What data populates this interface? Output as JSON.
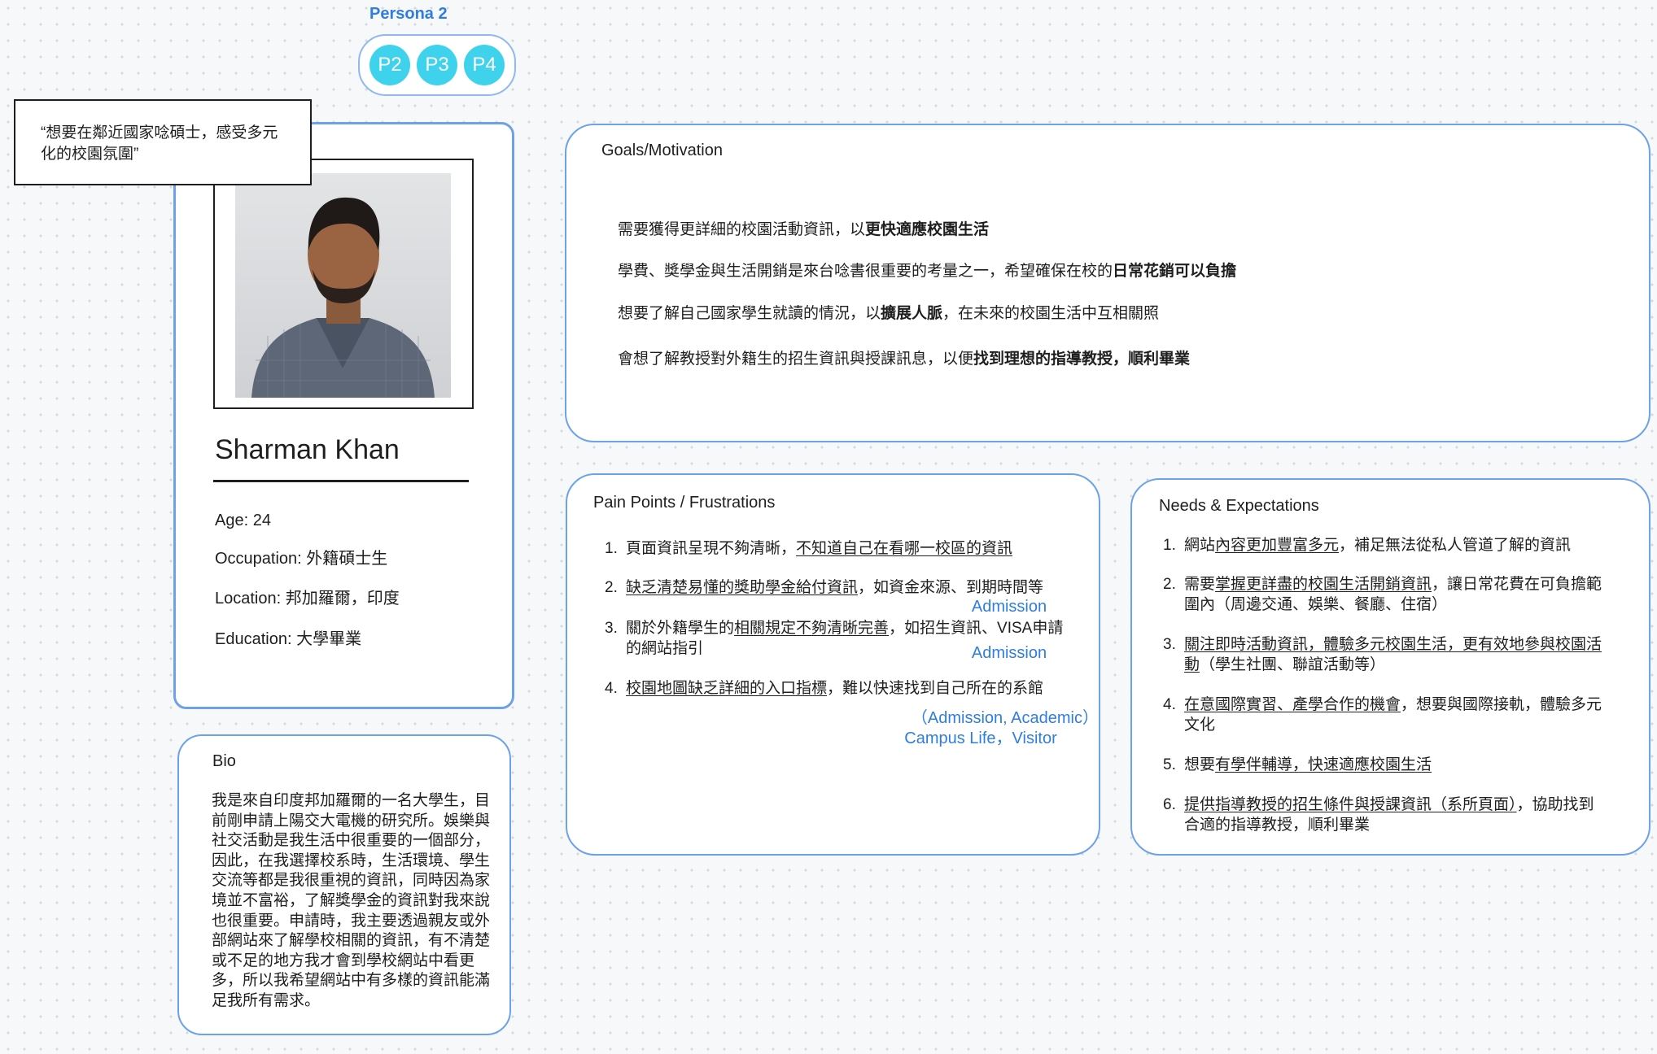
{
  "frame_label": "Persona 2",
  "persona_chips": [
    "P2",
    "P3",
    "P4"
  ],
  "quote": "“想要在鄰近國家唸碩士，感受多元化的校園氛圍”",
  "profile": {
    "name": "Sharman Khan",
    "age_label": "Age: ",
    "age": "24",
    "occupation_label": "Occupation: ",
    "occupation": "外籍碩士生",
    "location_label": "Location: ",
    "location": "邦加羅爾，印度",
    "education_label": "Education: ",
    "education": "大學畢業"
  },
  "bio": {
    "title": "Bio",
    "text": "我是來自印度邦加羅爾的一名大學生，目前剛申請上陽交大電機的研究所。娛樂與社交活動是我生活中很重要的一個部分，因此，在我選擇校系時，生活環境、學生交流等都是我很重視的資訊，同時因為家境並不富裕，了解獎學金的資訊對我來說也很重要。申請時，我主要透過親友或外部網站來了解學校相關的資訊，有不清楚或不足的地方我才會到學校網站中看更多，所以我希望網站中有多樣的資訊能滿足我所有需求。"
  },
  "goals": {
    "title": "Goals/Motivation",
    "items": [
      {
        "pre": "需要獲得更詳細的校園活動資訊，以",
        "bold": "更快適應校園生活",
        "post": ""
      },
      {
        "pre": "學費、獎學金與生活開銷是來台唸書很重要的考量之一，希望確保在校的",
        "bold": "日常花銷可以負擔",
        "post": ""
      },
      {
        "pre": "想要了解自己國家學生就讀的情況，以",
        "bold": "擴展人脈",
        "post": "，在未來的校園生活中互相關照"
      },
      {
        "pre": "會想了解教授對外籍生的招生資訊與授課訊息，以便",
        "bold": "找到理想的指導教授，順利畢業",
        "post": ""
      }
    ]
  },
  "pain_points": {
    "title": "Pain Points / Frustrations",
    "items": [
      {
        "num": "1.",
        "pre": "頁面資訊呈現不夠清晰，",
        "u": "不知道自己在看哪一校區的資訊",
        "post": ""
      },
      {
        "num": "2.",
        "pre": "",
        "u": "缺乏清楚易懂的獎助學金給付資訊",
        "post": "，如資金來源、到期時間等"
      },
      {
        "num": "3.",
        "pre": "關於外籍學生的",
        "u": "相關規定不夠清晰完善",
        "post": "，如招生資訊、VISA申請的網站指引"
      },
      {
        "num": "4.",
        "pre": "",
        "u": "校園地圖缺乏詳細的入口指標",
        "post": "，難以快速找到自己所在的系館"
      }
    ],
    "tags": [
      "Admission",
      "Admission",
      "（Admission, Academic）",
      "Campus Life，Visitor"
    ]
  },
  "needs": {
    "title": "Needs & Expectations",
    "items": [
      {
        "num": "1.",
        "pre": "網站",
        "u": "內容更加豐富多元",
        "post": "，補足無法從私人管道了解的資訊"
      },
      {
        "num": "2.",
        "pre": "需要",
        "u": "掌握更詳盡的校園生活開銷資訊",
        "post": "，讓日常花費在可負擔範圍內（周邊交通、娛樂、餐廳、住宿）"
      },
      {
        "num": "3.",
        "pre": "",
        "u": "關注即時活動資訊，體驗多元校園生活，更有效地參與校園活動",
        "post": "（學生社團、聯誼活動等）"
      },
      {
        "num": "4.",
        "pre": "",
        "u": "在意國際實習、產學合作的機會",
        "post": "，想要與國際接軌，體驗多元文化"
      },
      {
        "num": "5.",
        "pre": "想要",
        "u": "有學伴輔導，快速適應校園生活",
        "post": ""
      },
      {
        "num": "6.",
        "pre": "",
        "u": "提供指導教授的招生條件與授課資訊（系所頁面）",
        "post": "，協助找到合適的指導教授，順利畢業"
      }
    ]
  },
  "colors": {
    "accent": "#2f7de1",
    "chip": "#3ed2ec",
    "card_border": "#6da1e8"
  }
}
